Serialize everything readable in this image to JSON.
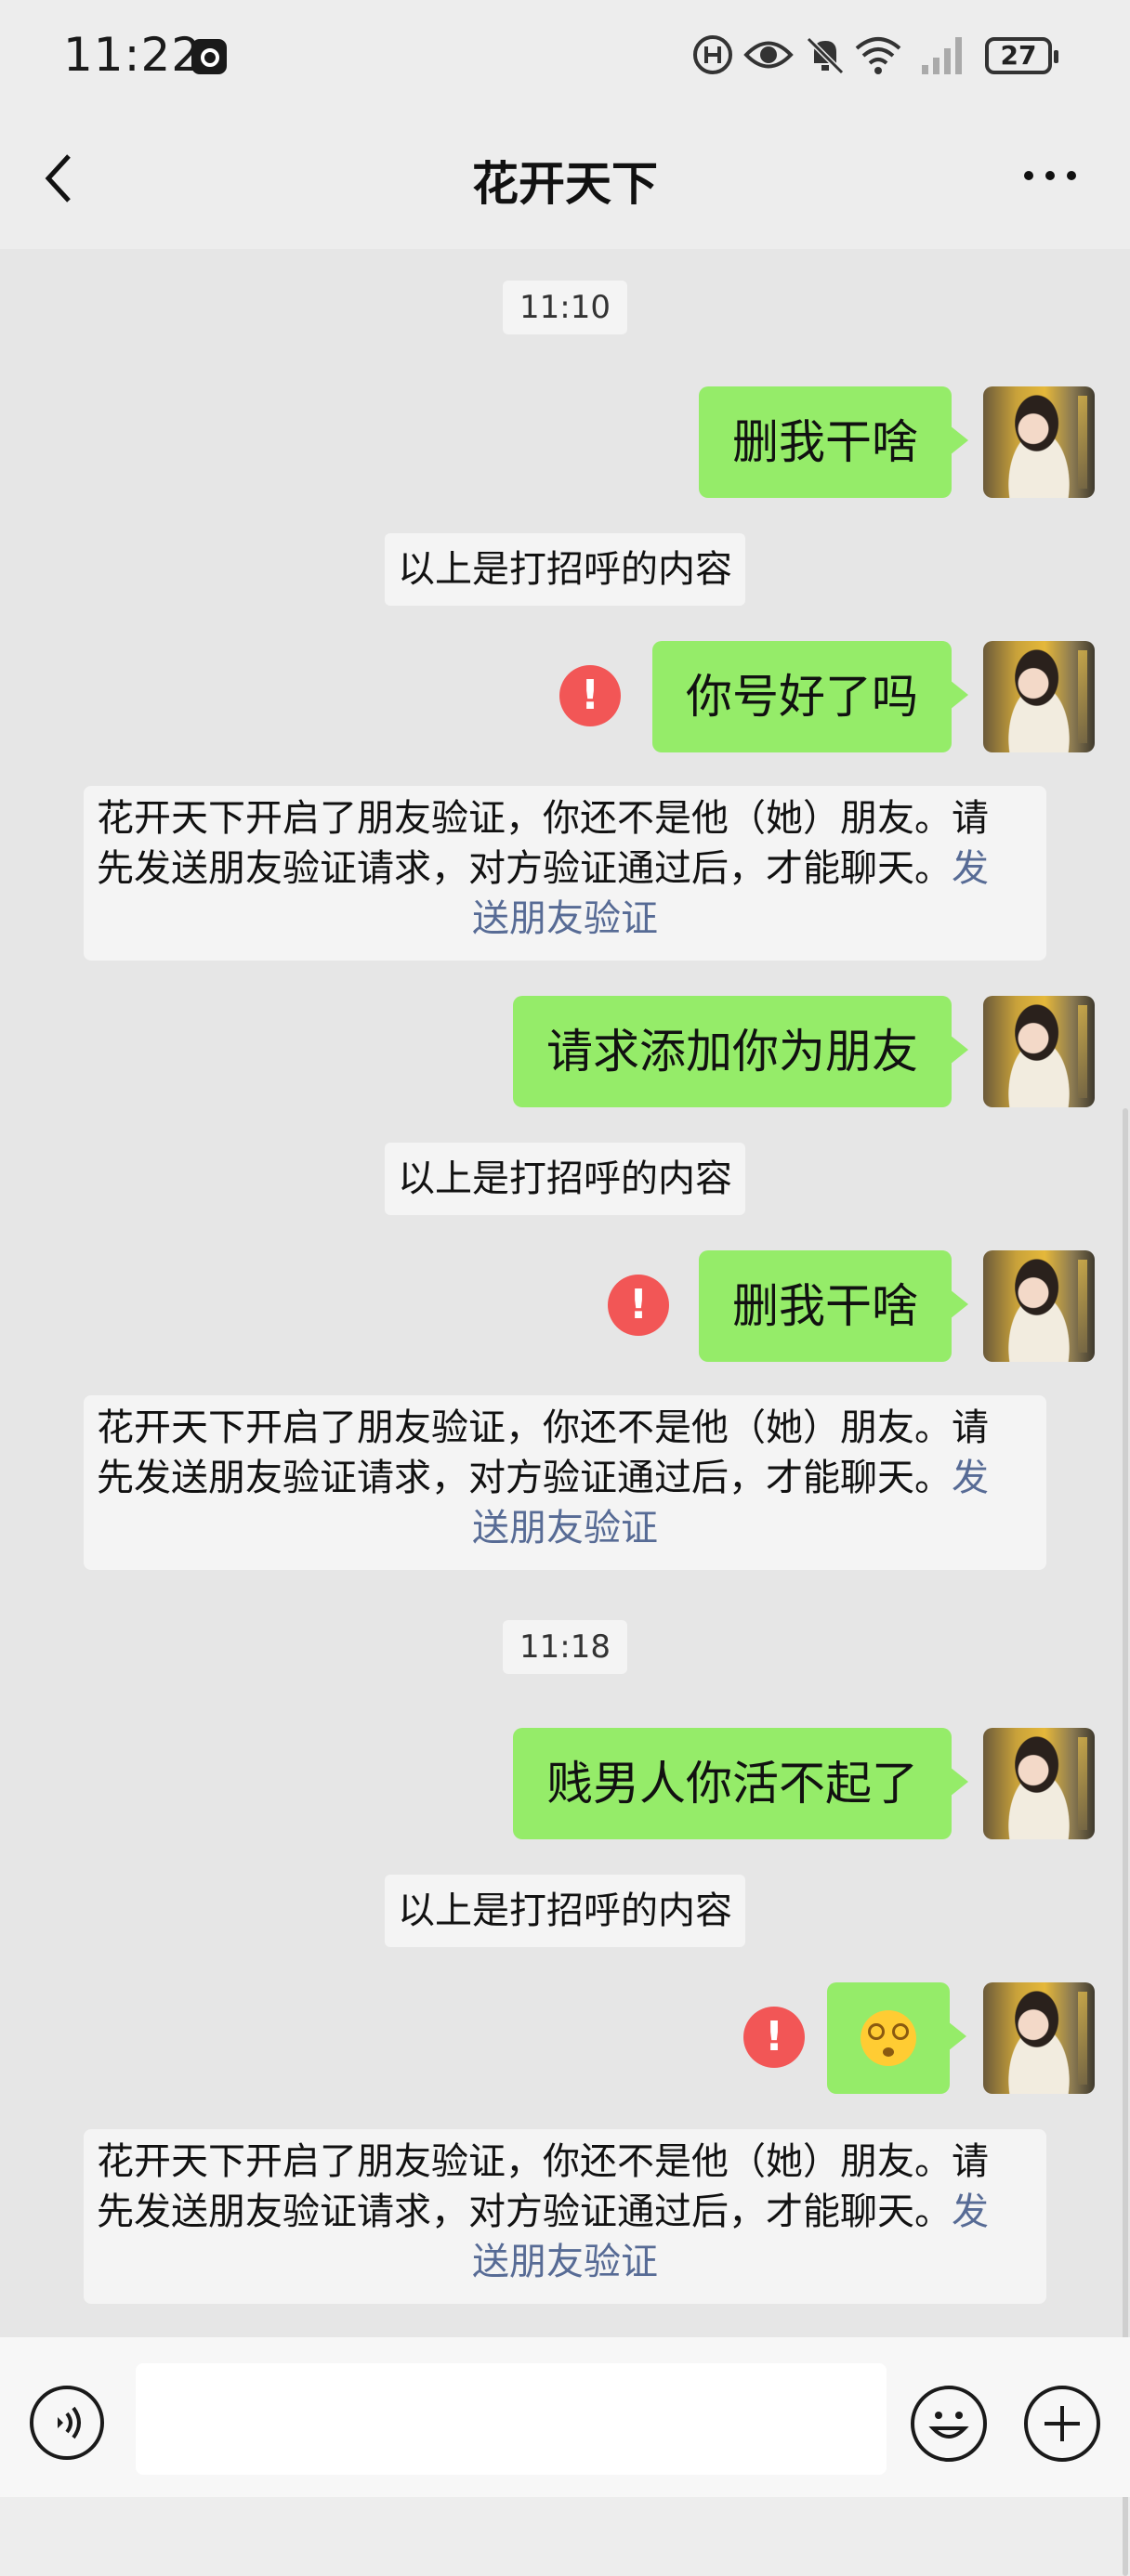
{
  "status_bar": {
    "time": "11:22",
    "battery": "27",
    "icons": [
      "app-notification-icon",
      "hd-call-icon",
      "eye-icon",
      "mute-bell-icon",
      "wifi-icon",
      "cellular-signal-icon",
      "battery-icon"
    ]
  },
  "header": {
    "title": "花开天下",
    "back_icon": "chevron-left-icon",
    "more_icon": "more-dots-icon"
  },
  "messages": [
    {
      "type": "time",
      "text": "11:10"
    },
    {
      "type": "outgoing",
      "text": "删我干啥",
      "failed": false
    },
    {
      "type": "hint",
      "text": "以上是打招呼的内容"
    },
    {
      "type": "outgoing",
      "text": "你号好了吗",
      "failed": true
    },
    {
      "type": "system",
      "line1": "花开天下开启了朋友验证，你还不是他（她）朋友。请",
      "line2": "先发送朋友验证请求，对方验证通过后，才能聊天。",
      "link_part1": "发",
      "link_part2": "送朋友验证"
    },
    {
      "type": "outgoing",
      "text": "请求添加你为朋友",
      "failed": false
    },
    {
      "type": "hint",
      "text": "以上是打招呼的内容"
    },
    {
      "type": "outgoing",
      "text": "删我干啥",
      "failed": true
    },
    {
      "type": "system",
      "line1": "花开天下开启了朋友验证，你还不是他（她）朋友。请",
      "line2": "先发送朋友验证请求，对方验证通过后，才能聊天。",
      "link_part1": "发",
      "link_part2": "送朋友验证"
    },
    {
      "type": "time",
      "text": "11:18"
    },
    {
      "type": "outgoing",
      "text": "贱男人你活不起了",
      "failed": false
    },
    {
      "type": "hint",
      "text": "以上是打招呼的内容"
    },
    {
      "type": "outgoing_emoji",
      "emoji": "dizzy-face-emoji",
      "failed": true
    },
    {
      "type": "system",
      "line1": "花开天下开启了朋友验证，你还不是他（她）朋友。请",
      "line2": "先发送朋友验证请求，对方验证通过后，才能聊天。",
      "link_part1": "发",
      "link_part2": "送朋友验证"
    }
  ],
  "error_mark": "!",
  "input_bar": {
    "value": "",
    "voice_icon": "voice-input-icon",
    "emoji_icon": "emoji-icon",
    "plus_icon": "plus-icon"
  },
  "colors": {
    "outgoing_bubble": "#95ec69",
    "error": "#f25656",
    "link": "#576b95",
    "background": "#e6e6e6"
  }
}
